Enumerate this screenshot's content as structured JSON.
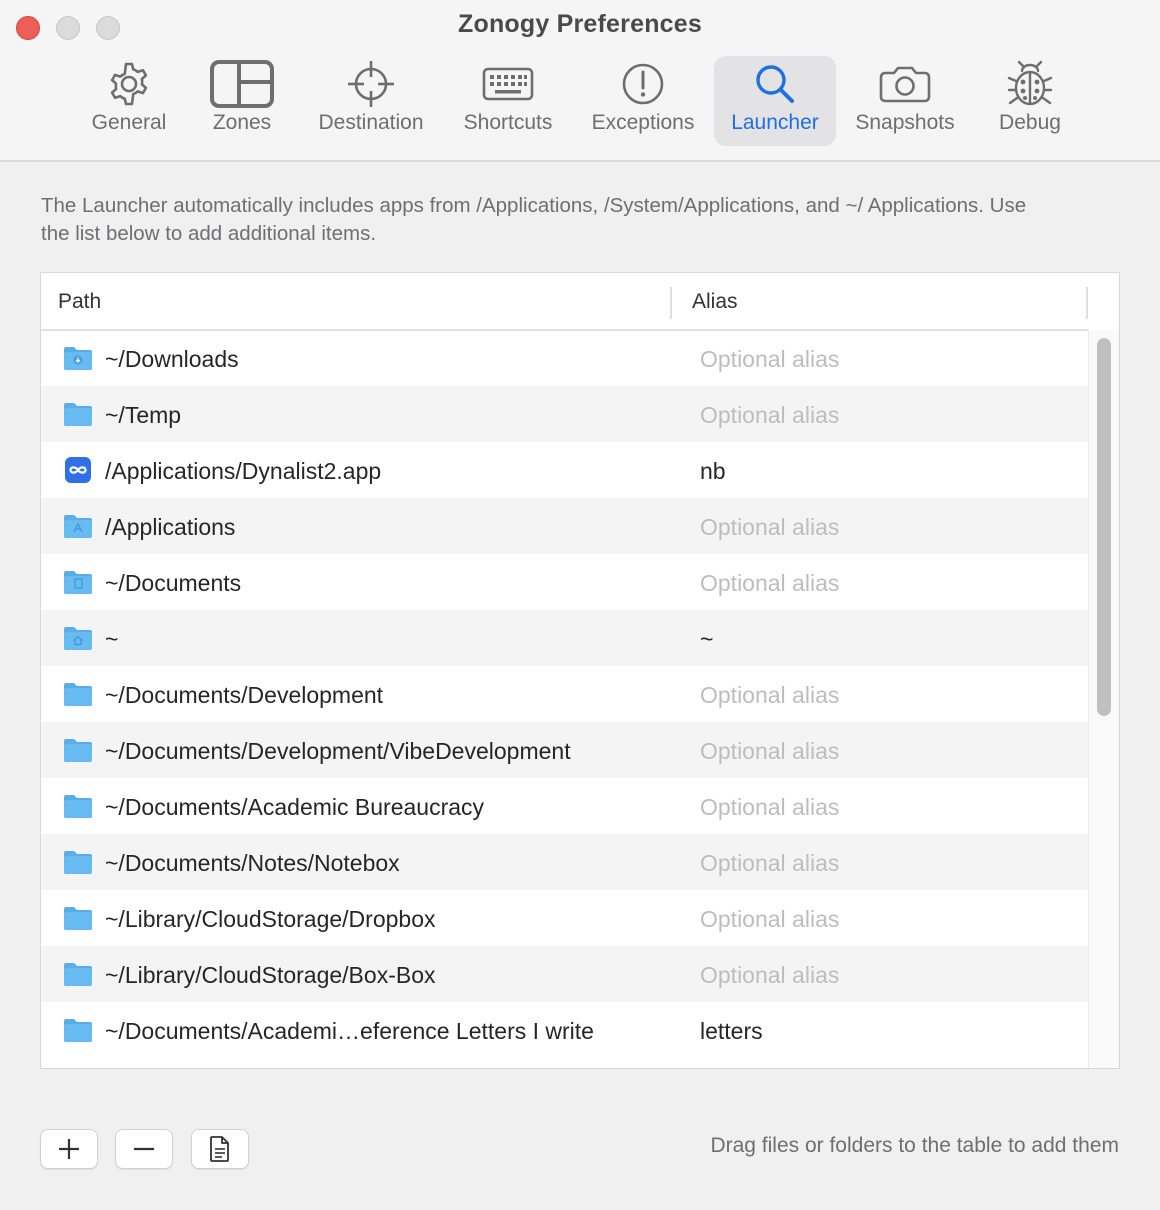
{
  "window": {
    "title": "Zonogy Preferences"
  },
  "tabs": [
    {
      "label": "General",
      "icon": "gear-icon"
    },
    {
      "label": "Zones",
      "icon": "zones-icon"
    },
    {
      "label": "Destination",
      "icon": "crosshair-icon"
    },
    {
      "label": "Shortcuts",
      "icon": "keyboard-icon"
    },
    {
      "label": "Exceptions",
      "icon": "exclamation-icon"
    },
    {
      "label": "Launcher",
      "icon": "magnifier-icon",
      "active": true
    },
    {
      "label": "Snapshots",
      "icon": "camera-icon"
    },
    {
      "label": "Debug",
      "icon": "bug-icon"
    }
  ],
  "launcher": {
    "description": "The Launcher automatically includes apps from /Applications, /System/Applications, and ~/ Applications. Use the list below to add additional items.",
    "table": {
      "columns": {
        "path": "Path",
        "alias": "Alias"
      },
      "alias_placeholder": "Optional alias",
      "rows": [
        {
          "path": "~/Downloads",
          "alias": "",
          "icon": "downloads-folder-icon"
        },
        {
          "path": "~/Temp",
          "alias": "",
          "icon": "folder-icon"
        },
        {
          "path": "/Applications/Dynalist2.app",
          "alias": "nb",
          "icon": "dynalist-app-icon"
        },
        {
          "path": "/Applications",
          "alias": "",
          "icon": "applications-folder-icon"
        },
        {
          "path": "~/Documents",
          "alias": "",
          "icon": "documents-folder-icon"
        },
        {
          "path": "~",
          "alias": "~",
          "icon": "home-folder-icon"
        },
        {
          "path": "~/Documents/Development",
          "alias": "",
          "icon": "folder-icon"
        },
        {
          "path": "~/Documents/Development/VibeDevelopment",
          "alias": "",
          "icon": "folder-icon"
        },
        {
          "path": "~/Documents/Academic Bureaucracy",
          "alias": "",
          "icon": "folder-icon"
        },
        {
          "path": "~/Documents/Notes/Notebox",
          "alias": "",
          "icon": "folder-icon"
        },
        {
          "path": "~/Library/CloudStorage/Dropbox",
          "alias": "",
          "icon": "folder-icon"
        },
        {
          "path": "~/Library/CloudStorage/Box-Box",
          "alias": "",
          "icon": "folder-icon"
        },
        {
          "path": "~/Documents/Academi…eference Letters I write",
          "alias": "letters",
          "icon": "folder-icon"
        }
      ]
    },
    "buttons": {
      "add": "+",
      "remove": "−",
      "document_icon": "document-icon"
    },
    "hint": "Drag files or folders to the table to add them"
  },
  "colors": {
    "accent": "#1f6fe0",
    "folder": "#5aaee8",
    "close": "#ee5f57"
  }
}
